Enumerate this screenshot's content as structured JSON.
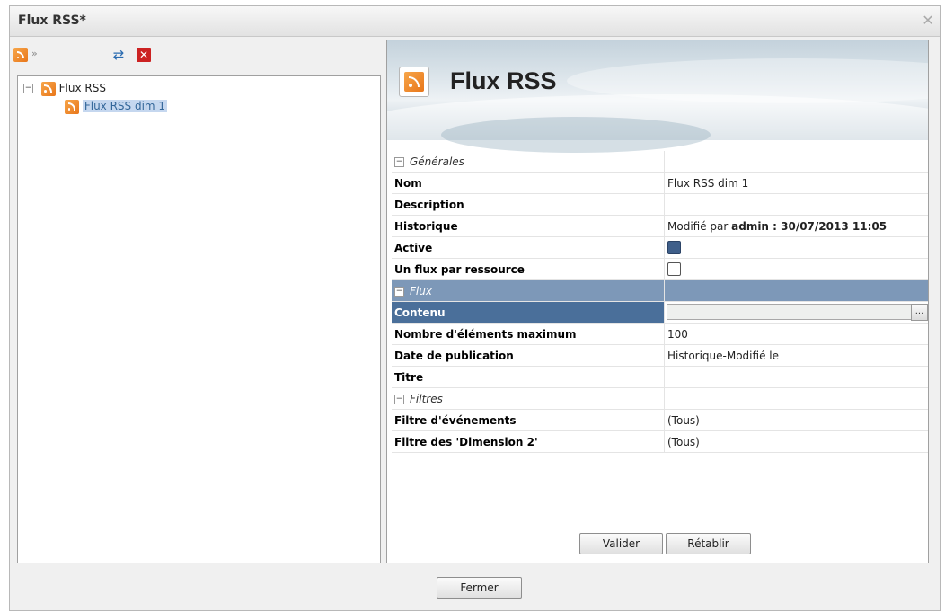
{
  "window": {
    "title": "Flux RSS*",
    "close_icon": "close-icon"
  },
  "toolbar": {
    "icons": [
      "rss-icon",
      "chevron-down-icon",
      "move-icon",
      "delete-icon"
    ]
  },
  "tree": {
    "root": {
      "label": "Flux RSS",
      "expanded": true
    },
    "child": {
      "label": "Flux RSS dim 1",
      "selected": true
    }
  },
  "detail": {
    "title": "Flux RSS",
    "sections": [
      {
        "name": "Générales"
      },
      {
        "name": "Flux"
      },
      {
        "name": "Filtres"
      }
    ],
    "properties": {
      "nom": {
        "label": "Nom",
        "value": "Flux RSS dim 1"
      },
      "description": {
        "label": "Description",
        "value": ""
      },
      "historique": {
        "label": "Historique",
        "prefix": "Modifié par ",
        "user": "admin : 30/07/2013 11:05"
      },
      "active": {
        "label": "Active",
        "checked": true
      },
      "un_flux": {
        "label": "Un flux par ressource",
        "checked": false
      },
      "contenu": {
        "label": "Contenu",
        "value": "",
        "button": "..."
      },
      "nombre": {
        "label": "Nombre d'éléments maximum",
        "value": "100"
      },
      "date": {
        "label": "Date de publication",
        "value": "Historique-Modifié le"
      },
      "titre": {
        "label": "Titre",
        "value": ""
      },
      "filtre_evt": {
        "label": "Filtre d'événements",
        "value": "(Tous)"
      },
      "filtre_dim": {
        "label": "Filtre des 'Dimension 2'",
        "value": "(Tous)"
      }
    }
  },
  "buttons": {
    "valider": "Valider",
    "retablir": "Rétablir",
    "fermer": "Fermer"
  },
  "colors": {
    "selected_row": "#4a6f9a",
    "selected_category": "#7d98b8",
    "rss_orange": "#e8761a"
  }
}
